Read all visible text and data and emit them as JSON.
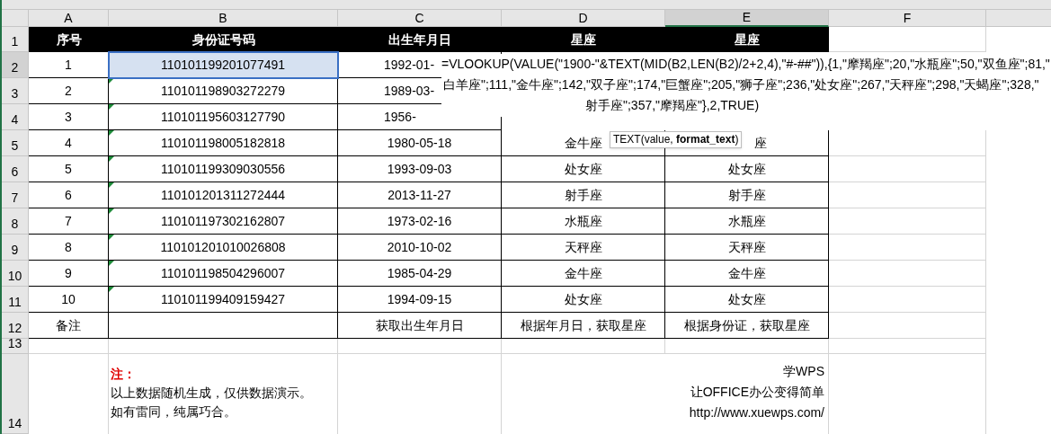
{
  "columns": [
    {
      "label": "A",
      "selected": false
    },
    {
      "label": "B",
      "selected": false
    },
    {
      "label": "C",
      "selected": false
    },
    {
      "label": "D",
      "selected": false
    },
    {
      "label": "E",
      "selected": true
    },
    {
      "label": "F",
      "selected": false
    }
  ],
  "header": [
    "序号",
    "身份证号码",
    "出生年月日",
    "星座",
    "星座"
  ],
  "rows": [
    {
      "row": "2",
      "cells": [
        "1",
        "110101199201077491",
        "1992-01-",
        "",
        ""
      ],
      "selected": true,
      "flagged": false,
      "kind": "covered"
    },
    {
      "row": "3",
      "cells": [
        "2",
        "110101198903272279",
        "1989-03-",
        "",
        ""
      ],
      "selected": false,
      "flagged": true,
      "kind": "covered"
    },
    {
      "row": "4",
      "cells": [
        "3",
        "110101195603127790",
        "1956-",
        "",
        ""
      ],
      "selected": false,
      "flagged": true,
      "kind": "covered"
    },
    {
      "row": "5",
      "cells": [
        "4",
        "110101198005182818",
        "1980-05-18",
        "金牛座",
        "座"
      ],
      "selected": false,
      "flagged": true,
      "kind": "tooltip"
    },
    {
      "row": "6",
      "cells": [
        "5",
        "110101199309030556",
        "1993-09-03",
        "处女座",
        "处女座"
      ],
      "selected": false,
      "flagged": true,
      "kind": "plain"
    },
    {
      "row": "7",
      "cells": [
        "6",
        "110101201311272444",
        "2013-11-27",
        "射手座",
        "射手座"
      ],
      "selected": false,
      "flagged": true,
      "kind": "plain"
    },
    {
      "row": "8",
      "cells": [
        "7",
        "110101197302162807",
        "1973-02-16",
        "水瓶座",
        "水瓶座"
      ],
      "selected": false,
      "flagged": true,
      "kind": "plain"
    },
    {
      "row": "9",
      "cells": [
        "8",
        "110101201010026808",
        "2010-10-02",
        "天秤座",
        "天秤座"
      ],
      "selected": false,
      "flagged": true,
      "kind": "plain"
    },
    {
      "row": "10",
      "cells": [
        "9",
        "110101198504296007",
        "1985-04-29",
        "金牛座",
        "金牛座"
      ],
      "selected": false,
      "flagged": true,
      "kind": "plain"
    },
    {
      "row": "11",
      "cells": [
        "10",
        "110101199409159427",
        "1994-09-15",
        "处女座",
        "处女座"
      ],
      "selected": false,
      "flagged": true,
      "kind": "plain"
    }
  ],
  "row_numbers": {
    "header": "1",
    "remarks": "12",
    "spacer": "13",
    "notes": "14"
  },
  "remarks": [
    "备注",
    "获取出生年月日",
    "根据年月日，获取星座",
    "根据身份证，获取星座"
  ],
  "formula_lines": [
    "=VLOOKUP(VALUE(\"1900-\"&TEXT(MID(B2,LEN(B2)/2+2,4),\"#-##\")),{1,\"摩羯座\";20,\"水瓶座\";50,\"双鱼座\";81,\"",
    "白羊座\";111,\"金牛座\";142,\"双子座\";174,\"巨蟹座\";205,\"狮子座\";236,\"处女座\";267,\"天秤座\";298,\"天蝎座\";328,\"",
    "射手座\";357,\"摩羯座\"},2,TRUE)"
  ],
  "tooltip": "TEXT(value, **format_text**)",
  "note": {
    "title": "注：",
    "lines": [
      "以上数据随机生成，仅供数据演示。",
      "如有雷同，纯属巧合。"
    ]
  },
  "credit": [
    "学WPS",
    "让OFFICE办公变得简单",
    "http://www.xuewps.com/"
  ]
}
